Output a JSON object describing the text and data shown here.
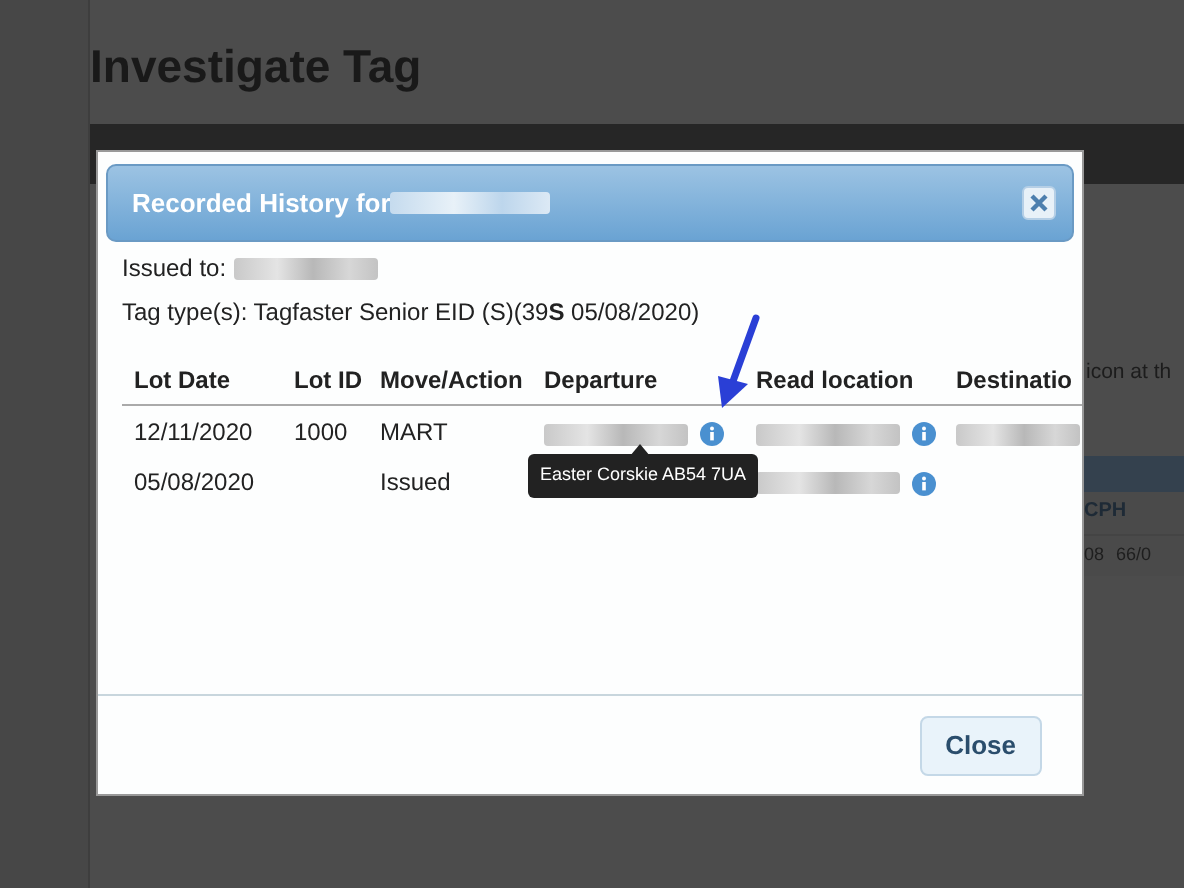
{
  "page": {
    "title": "Investigate Tag",
    "text_fragment": "icon at th",
    "table_header": "CPH",
    "cells": [
      "08",
      "66/0"
    ]
  },
  "dialog": {
    "title": "Recorded History for",
    "title_redacted": true,
    "issued_label": "Issued to:",
    "issued_redacted": true,
    "tag_type": "Tag type(s): Tagfaster Senior EID (S)(39**S** 05/08/2020)",
    "columns": [
      "Lot Date",
      "Lot ID",
      "Move/Action",
      "Departure",
      "Read location",
      "Destinatio"
    ],
    "rows": [
      {
        "cells": [
          {
            "text": "12/11/2020"
          },
          {
            "text": "1000"
          },
          {
            "text": "MART"
          },
          {
            "redacted": true,
            "info": true
          },
          {
            "redacted": true,
            "info": true
          },
          {
            "redacted": true
          }
        ]
      },
      {
        "cells": [
          {
            "text": "05/08/2020"
          },
          {},
          {
            "text": "Issued"
          },
          {},
          {
            "redacted": true,
            "info": true
          },
          {}
        ]
      }
    ],
    "tooltip": "Easter Corskie AB54 7UA",
    "button": "Close"
  }
}
